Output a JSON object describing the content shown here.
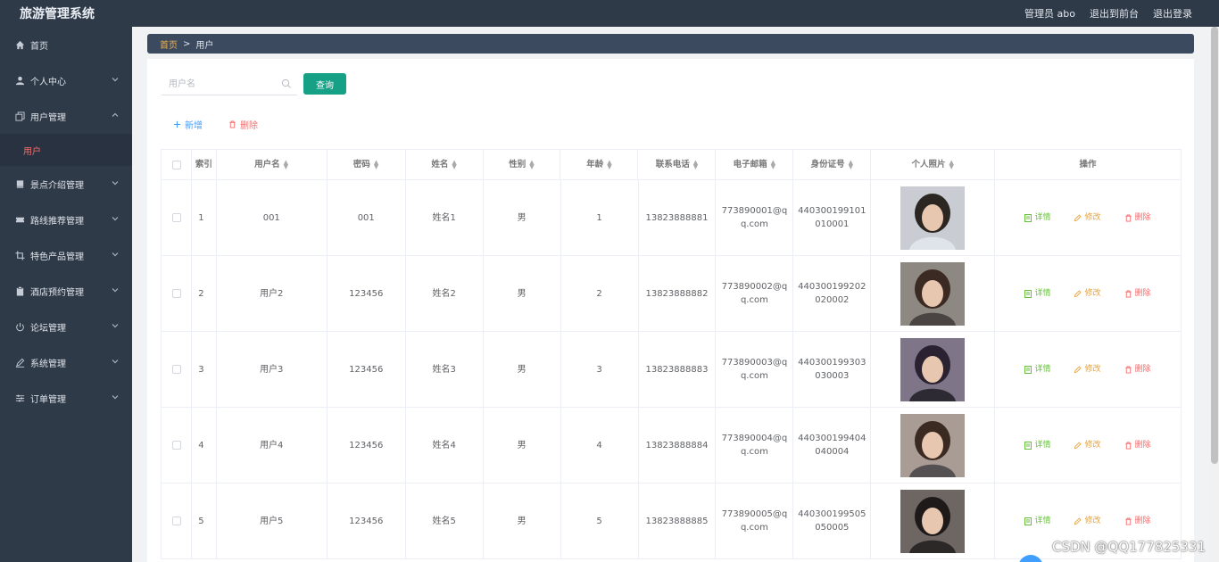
{
  "app": {
    "title": "旅游管理系统"
  },
  "header": {
    "admin": "管理员 abo",
    "front": "退出到前台",
    "logout": "退出登录"
  },
  "sidebar": {
    "items": [
      {
        "label": "首页",
        "icon": "home-icon"
      },
      {
        "label": "个人中心",
        "icon": "user-icon"
      },
      {
        "label": "用户管理",
        "icon": "copy-icon"
      },
      {
        "label": "景点介绍管理",
        "icon": "book-icon"
      },
      {
        "label": "路线推荐管理",
        "icon": "ticket-icon"
      },
      {
        "label": "特色产品管理",
        "icon": "crop-icon"
      },
      {
        "label": "酒店预约管理",
        "icon": "clipboard-icon"
      },
      {
        "label": "论坛管理",
        "icon": "power-icon"
      },
      {
        "label": "系统管理",
        "icon": "edit-icon"
      },
      {
        "label": "订单管理",
        "icon": "sliders-icon"
      }
    ],
    "submenu_user": "用户"
  },
  "breadcrumb": {
    "home": "首页",
    "sep": ">",
    "current": "用户"
  },
  "search": {
    "placeholder": "用户名",
    "button": "查询"
  },
  "actions": {
    "add": "新增",
    "delete": "删除"
  },
  "table": {
    "headers": [
      "索引",
      "用户名",
      "密码",
      "姓名",
      "性别",
      "年龄",
      "联系电话",
      "电子邮箱",
      "身份证号",
      "个人照片",
      "操作"
    ],
    "rows": [
      {
        "index": "1",
        "username": "001",
        "password": "001",
        "name": "姓名1",
        "gender": "男",
        "age": "1",
        "phone": "13823888881",
        "email": "773890001@qq.com",
        "idcard": "440300199101010001"
      },
      {
        "index": "2",
        "username": "用户2",
        "password": "123456",
        "name": "姓名2",
        "gender": "男",
        "age": "2",
        "phone": "13823888882",
        "email": "773890002@qq.com",
        "idcard": "440300199202020002"
      },
      {
        "index": "3",
        "username": "用户3",
        "password": "123456",
        "name": "姓名3",
        "gender": "男",
        "age": "3",
        "phone": "13823888883",
        "email": "773890003@qq.com",
        "idcard": "440300199303030003"
      },
      {
        "index": "4",
        "username": "用户4",
        "password": "123456",
        "name": "姓名4",
        "gender": "男",
        "age": "4",
        "phone": "13823888884",
        "email": "773890004@qq.com",
        "idcard": "440300199404040004"
      },
      {
        "index": "5",
        "username": "用户5",
        "password": "123456",
        "name": "姓名5",
        "gender": "男",
        "age": "5",
        "phone": "13823888885",
        "email": "773890005@qq.com",
        "idcard": "440300199505050005"
      }
    ],
    "ops": {
      "detail": "详情",
      "edit": "修改",
      "delete": "删除"
    }
  },
  "colors": {
    "sidebar": "#2f3a49",
    "accent": "#16a085",
    "danger": "#f56c6c",
    "warning": "#e6a23c",
    "success": "#67c23a",
    "primary": "#409eff"
  },
  "watermark": "CSDN @QQ177825331"
}
